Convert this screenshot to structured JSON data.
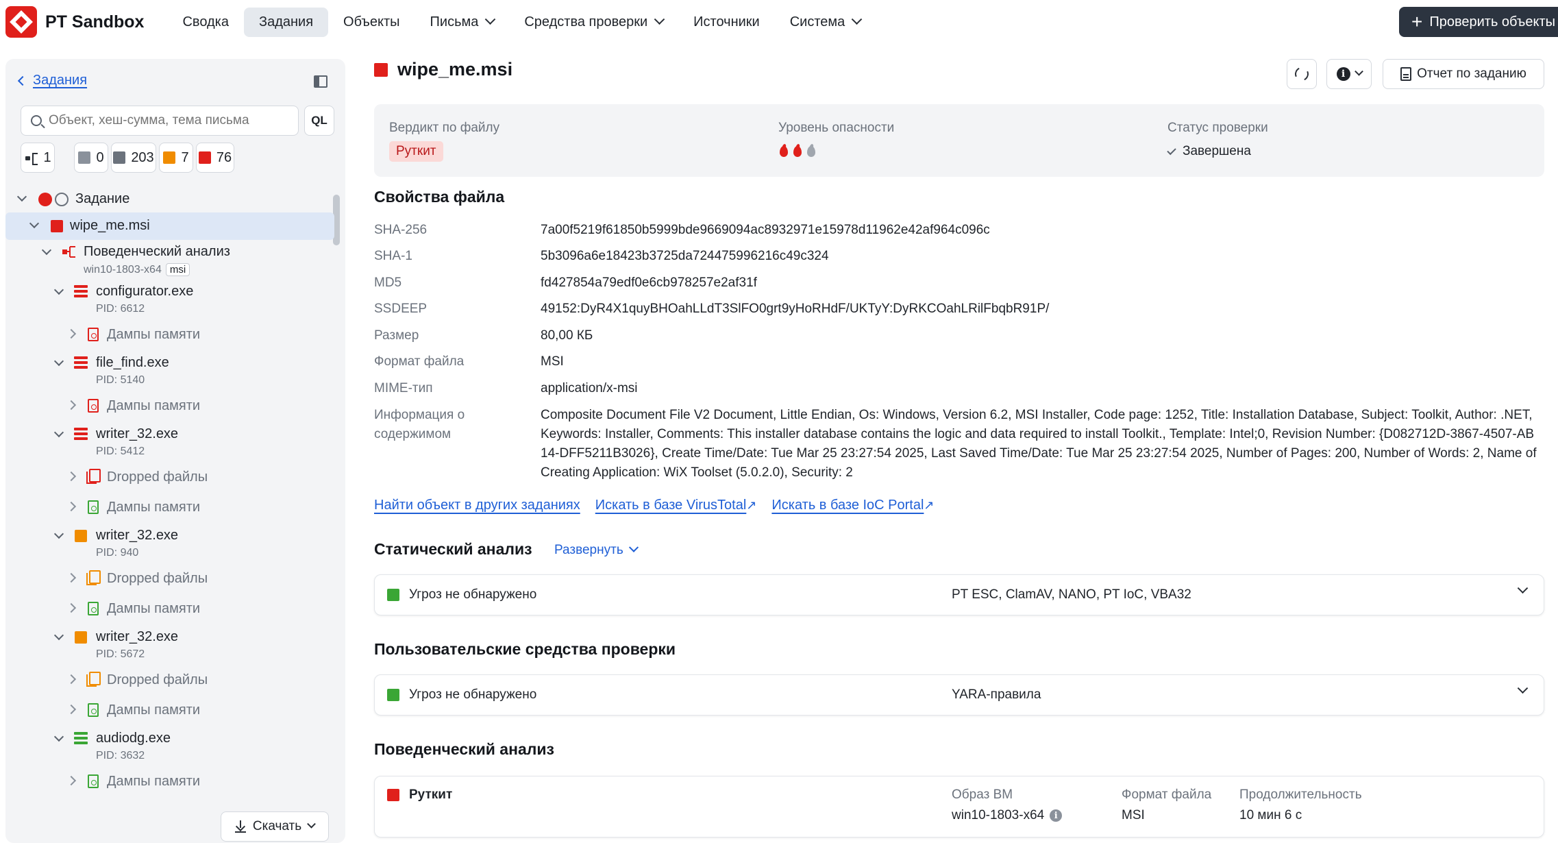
{
  "app": {
    "name": "PT Sandbox"
  },
  "nav": {
    "items": [
      {
        "label": "Сводка",
        "active": false,
        "dropdown": false
      },
      {
        "label": "Задания",
        "active": true,
        "dropdown": false
      },
      {
        "label": "Объекты",
        "active": false,
        "dropdown": false
      },
      {
        "label": "Письма",
        "active": false,
        "dropdown": true
      },
      {
        "label": "Средства проверки",
        "active": false,
        "dropdown": true
      },
      {
        "label": "Источники",
        "active": false,
        "dropdown": false
      },
      {
        "label": "Система",
        "active": false,
        "dropdown": true
      }
    ],
    "check_button": "Проверить объекты"
  },
  "sidebar": {
    "back_label": "Задания",
    "search_placeholder": "Объект, хеш-сумма, тема письма",
    "ql_label": "QL",
    "counters": {
      "tree": "1",
      "gray": "0",
      "dark": "203",
      "orange": "7",
      "red": "76"
    },
    "tree": {
      "root": "Задание",
      "file": "wipe_me.msi",
      "behavior": {
        "label": "Поведенческий анализ",
        "vm": "win10-1803-x64",
        "tag": "msi"
      },
      "processes": [
        {
          "name": "configurator.exe",
          "pid": "PID: 6612",
          "children": [
            "Дампы памяти"
          ]
        },
        {
          "name": "file_find.exe",
          "pid": "PID: 5140",
          "children": [
            "Дампы памяти"
          ]
        },
        {
          "name": "writer_32.exe",
          "pid": "PID: 5412",
          "children": [
            "Dropped файлы",
            "Дампы памяти"
          ]
        },
        {
          "name": "writer_32.exe",
          "pid": "PID: 940",
          "children": [
            "Dropped файлы",
            "Дампы памяти"
          ]
        },
        {
          "name": "writer_32.exe",
          "pid": "PID: 5672",
          "children": [
            "Dropped файлы",
            "Дампы памяти"
          ]
        },
        {
          "name": "audiodg.exe",
          "pid": "PID: 3632",
          "children": [
            "Дампы памяти"
          ]
        }
      ]
    },
    "download_label": "Скачать"
  },
  "main": {
    "title": "wipe_me.msi",
    "report_button": "Отчет по заданию",
    "verdict": {
      "file_verdict_label": "Вердикт по файлу",
      "file_verdict": "Руткит",
      "danger_label": "Уровень опасности",
      "status_label": "Статус проверки",
      "status": "Завершена"
    },
    "file_props": {
      "heading": "Свойства файла",
      "rows": [
        {
          "k": "SHA-256",
          "v": "7a00f5219f61850b5999bde9669094ac8932971e15978d11962e42af964c096c"
        },
        {
          "k": "SHA-1",
          "v": "5b3096a6e18423b3725da724475996216c49c324"
        },
        {
          "k": "MD5",
          "v": "fd427854a79edf0e6cb978257e2af31f"
        },
        {
          "k": "SSDEEP",
          "v": "49152:DyR4X1quyBHOahLLdT3SlFO0grt9yHoRHdF/UKTyY:DyRKCOahLRilFbqbR91P/"
        },
        {
          "k": "Размер",
          "v": "80,00 КБ"
        },
        {
          "k": "Формат файла",
          "v": "MSI"
        },
        {
          "k": "MIME-тип",
          "v": "application/x-msi"
        },
        {
          "k": "Информация о содержимом",
          "v": "Composite Document File V2 Document, Little Endian, Os: Windows, Version 6.2, MSI Installer, Code page: 1252, Title: Installation Database, Subject: Toolkit, Author: .NET, Keywords: Installer, Comments: This installer database contains the logic and data required to install Toolkit., Template: Intel;0, Revision Number: {D082712D-3867-4507-AB14-DFF5211B3026}, Create Time/Date: Tue Mar 25 23:27:54 2025, Last Saved Time/Date: Tue Mar 25 23:27:54 2025, Number of Pages: 200, Number of Words: 2, Name of Creating Application: WiX Toolset (5.0.2.0), Security: 2"
        }
      ],
      "links": [
        "Найти объект в других заданиях",
        "Искать в базе VirusTotal",
        "Искать в базе IoC Portal"
      ]
    },
    "static": {
      "heading": "Статический анализ",
      "expand": "Развернуть",
      "result": "Угроз не обнаружено",
      "tools": "PT ESC, ClamAV, NANO, PT IoC, VBA32"
    },
    "custom": {
      "heading": "Пользовательские средства проверки",
      "result": "Угроз не обнаружено",
      "tools": "YARA-правила"
    },
    "behavior": {
      "heading": "Поведенческий анализ",
      "result": "Руткит",
      "vm_label": "Образ ВМ",
      "vm": "win10-1803-x64",
      "format_label": "Формат файла",
      "format": "MSI",
      "duration_label": "Продолжительность",
      "duration": "10 мин 6 с"
    }
  },
  "colors": {
    "red": "#e0201b",
    "orange": "#f08c00",
    "green": "#3aa635",
    "gray": "#8a919b",
    "dark": "#4a525c",
    "link": "#1f5fd6"
  }
}
